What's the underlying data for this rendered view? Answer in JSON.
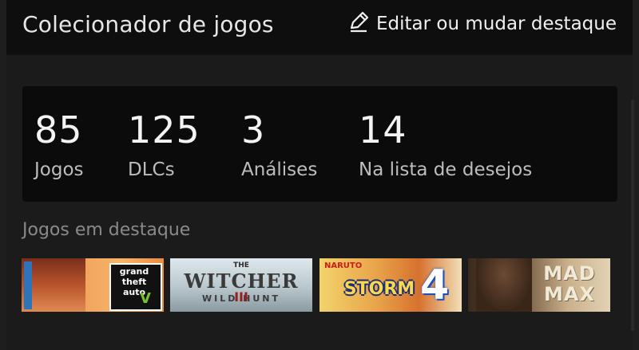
{
  "header": {
    "title": "Colecionador de jogos",
    "edit_label": "Editar ou mudar destaque",
    "edit_icon": "pencil-icon"
  },
  "stats": [
    {
      "value": "85",
      "label": "Jogos"
    },
    {
      "value": "125",
      "label": "DLCs"
    },
    {
      "value": "3",
      "label": "Análises"
    },
    {
      "value": "14",
      "label": "Na lista de desejos"
    }
  ],
  "featured": {
    "label": "Jogos em destaque",
    "games": [
      {
        "logo_lines": [
          "grand",
          "theft",
          "auto"
        ],
        "numeral": "V"
      },
      {
        "logo_small": "THE",
        "logo_main": "WITCHER",
        "logo_sub": "WILD HUNT",
        "numeral": "III"
      },
      {
        "logo_small": "NARUTO",
        "logo_main": "STORM",
        "numeral": "4"
      },
      {
        "logo_lines": [
          "MAD",
          "MAX"
        ]
      }
    ]
  },
  "colors": {
    "background": "#1e1e1e",
    "header_bg": "#0e0e0e",
    "stats_bg": "#0b0b0b",
    "muted_text": "#8a8a8a"
  }
}
